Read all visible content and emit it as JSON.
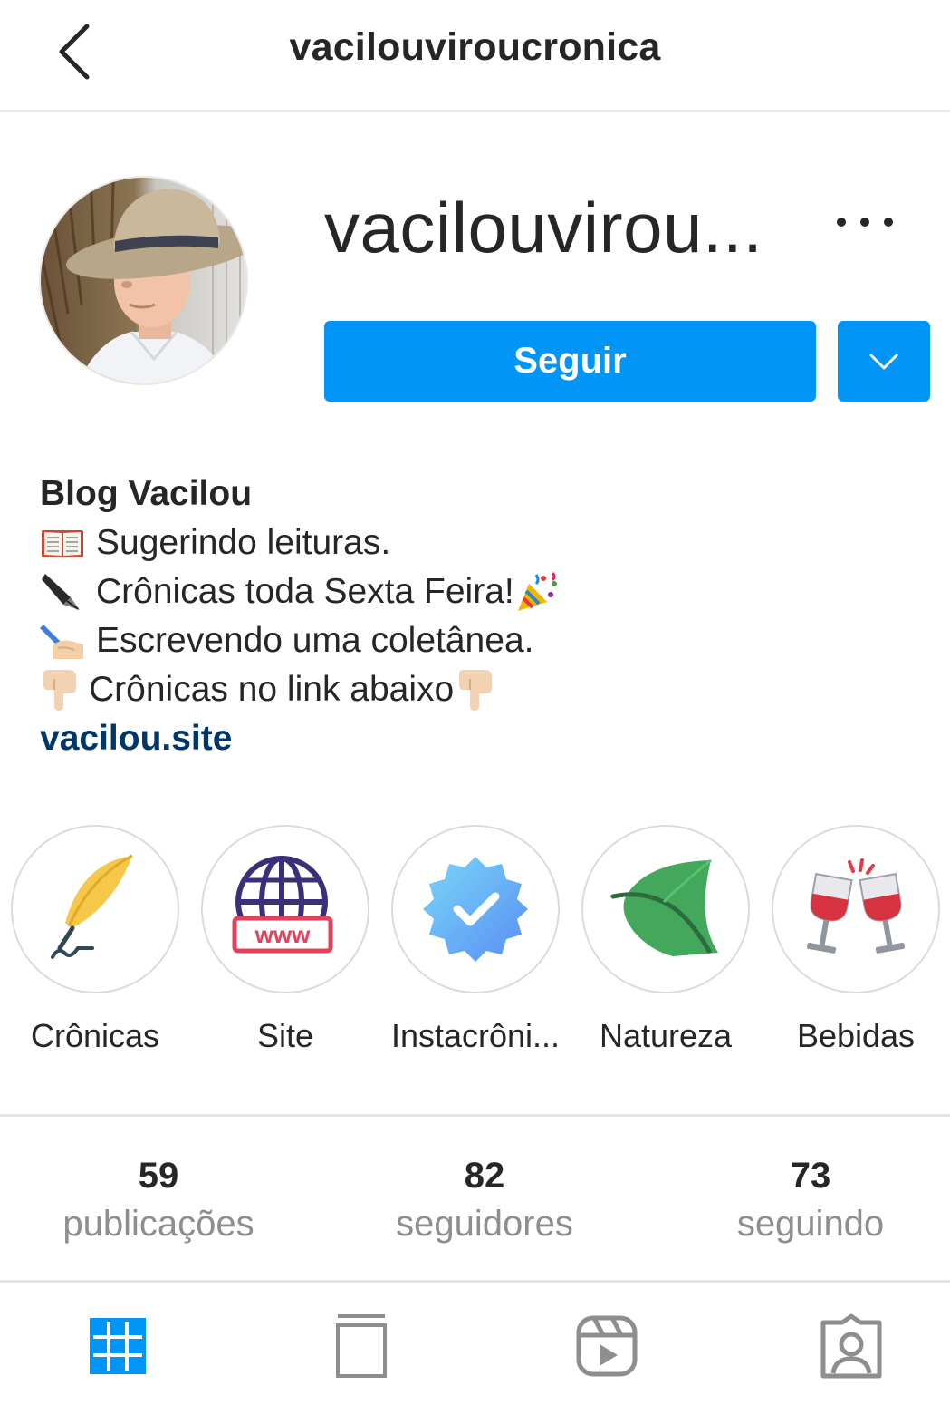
{
  "header": {
    "title": "vacilouviroucronica",
    "back_icon": "chevron-left-icon"
  },
  "profile": {
    "username_display": "vacilouvirou...",
    "follow_label": "Seguir",
    "more_icon": "more-horizontal-icon",
    "dropdown_icon": "chevron-down-icon",
    "accent_color": "#0095f6"
  },
  "bio": {
    "full_name": "Blog Vacilou",
    "lines": [
      {
        "icon": "open-book-emoji",
        "text": "Sugerindo leituras."
      },
      {
        "icon": "fountain-pen-emoji",
        "text": "Crônicas toda Sexta Feira!",
        "trailing_icon": "party-popper-emoji"
      },
      {
        "icon": "writing-hand-emoji",
        "text": "Escrevendo uma coletânea."
      },
      {
        "icon": "pointing-down-emoji",
        "text": "Crônicas no link abaixo",
        "trailing_icon": "pointing-down-emoji"
      }
    ],
    "link": "vacilou.site",
    "link_color": "#00376b"
  },
  "highlights": [
    {
      "label": "Crônicas",
      "icon": "quill-feather-icon"
    },
    {
      "label": "Site",
      "icon": "www-globe-icon"
    },
    {
      "label": "Instacrôni...",
      "icon": "verified-badge-icon"
    },
    {
      "label": "Natureza",
      "icon": "leaf-icon"
    },
    {
      "label": "Bebidas",
      "icon": "wine-glasses-toast-icon"
    }
  ],
  "stats": [
    {
      "value": "59",
      "label": "publicações"
    },
    {
      "value": "82",
      "label": "seguidores"
    },
    {
      "value": "73",
      "label": "seguindo"
    }
  ],
  "tabs": [
    {
      "name": "grid",
      "icon": "grid-icon",
      "active": true
    },
    {
      "name": "igtv",
      "icon": "igtv-icon",
      "active": false
    },
    {
      "name": "reels",
      "icon": "reels-icon",
      "active": false
    },
    {
      "name": "tagged",
      "icon": "tagged-user-icon",
      "active": false
    }
  ]
}
